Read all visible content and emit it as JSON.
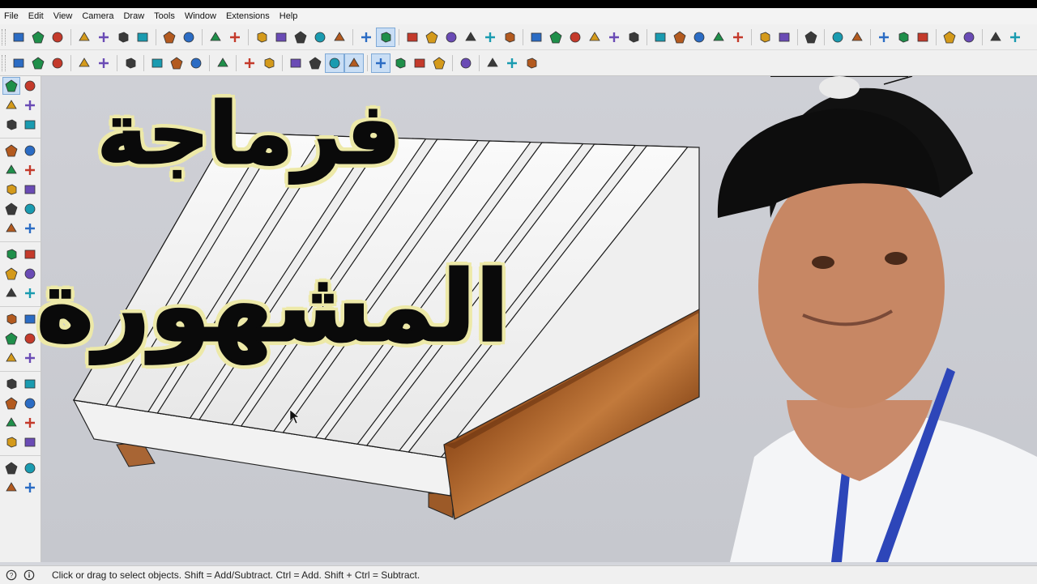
{
  "menubar": {
    "items": [
      "File",
      "Edit",
      "View",
      "Camera",
      "Draw",
      "Tools",
      "Window",
      "Extensions",
      "Help"
    ]
  },
  "toolbar1": {
    "icons": [
      "new-icon",
      "open-icon",
      "save-icon",
      "cut-icon",
      "copy-icon",
      "paste-icon",
      "erase-icon",
      "undo-icon",
      "redo-icon",
      "print-icon",
      "model-info-icon",
      "xray-icon",
      "back-edges-icon",
      "wireframe-icon",
      "hidden-line-icon",
      "shaded-icon",
      "shaded-textures-icon",
      "monochrome-icon",
      "iso-view-icon",
      "top-view-icon",
      "front-view-icon",
      "right-view-icon",
      "back-view-icon",
      "left-view-icon",
      "components-icon",
      "groups-icon",
      "outliner-icon",
      "layers-icon",
      "styles-icon",
      "scenes-icon",
      "solid-union-icon",
      "solid-subtract-icon",
      "solid-trim-icon",
      "solid-split-icon",
      "solid-intersect-icon",
      "warehouse-icon",
      "layout-icon",
      "play-icon",
      "extension-1-icon",
      "extension-2-icon",
      "extension-3-icon",
      "extension-4-icon",
      "extension-5-icon",
      "extension-6-icon",
      "extension-7-icon",
      "extension-8-icon",
      "extension-9-icon"
    ]
  },
  "toolbar2": {
    "icons": [
      "box-icon",
      "box-open-icon",
      "box-textured-icon",
      "sandbox-icon",
      "section-icon",
      "pencil-tool-icon",
      "dimension-icon",
      "rotate-3d-icon",
      "paint-icon",
      "materials-icon",
      "scale-icon",
      "balance-icon",
      "axes-icon",
      "camera-orbit-icon",
      "camera-pan-icon",
      "camera-zoom-icon",
      "geo-location-icon",
      "geo-terrain-icon",
      "dynamic-icon",
      "photo-match-icon",
      "shadow-icon",
      "compass-icon",
      "solar-icon",
      "clock-icon"
    ]
  },
  "left_toolbar": {
    "rows": [
      [
        "select-arrow-icon",
        "orbit-icon"
      ],
      [
        "make-component-icon",
        "eraser-icon"
      ],
      [
        "paint-bucket-icon",
        "eyedropper-icon"
      ],
      [
        "line-tool-icon",
        "freehand-icon"
      ],
      [
        "rectangle-icon",
        "rotated-rectangle-icon"
      ],
      [
        "circle-icon",
        "polygon-icon"
      ],
      [
        "arc-icon",
        "two-point-arc-icon"
      ],
      [
        "pie-icon",
        "three-point-arc-icon"
      ],
      [
        "move-icon",
        "push-pull-icon"
      ],
      [
        "rotate-icon",
        "follow-me-icon"
      ],
      [
        "scale-tool-icon",
        "offset-icon"
      ],
      [
        "tape-measure-icon",
        "text-tool-icon"
      ],
      [
        "protractor-icon",
        "three-d-text-icon"
      ],
      [
        "axes-tool-icon",
        "section-plane-icon"
      ],
      [
        "pan-icon",
        "zoom-window-icon"
      ],
      [
        "zoom-icon",
        "zoom-extents-icon"
      ],
      [
        "previous-view-icon",
        "look-around-icon"
      ],
      [
        "position-camera-icon",
        "walk-icon"
      ],
      [
        "footprint-icon",
        "section-display-icon"
      ],
      [
        "sandbox-smoove-icon",
        "stamp-icon"
      ]
    ]
  },
  "viewport": {
    "title_line1": "فرماجة",
    "title_line2": "المشهورة"
  },
  "statusbar": {
    "message": "Click or drag to select objects. Shift = Add/Subtract. Ctrl = Add. Shift + Ctrl = Subtract."
  },
  "colors": {
    "title_fill": "#0a0a0a",
    "title_outline": "#ede9a8",
    "slat_white": "#f4f4f4",
    "wood": "#8a4a1e",
    "viewport_bg": "#cdcfd5"
  }
}
